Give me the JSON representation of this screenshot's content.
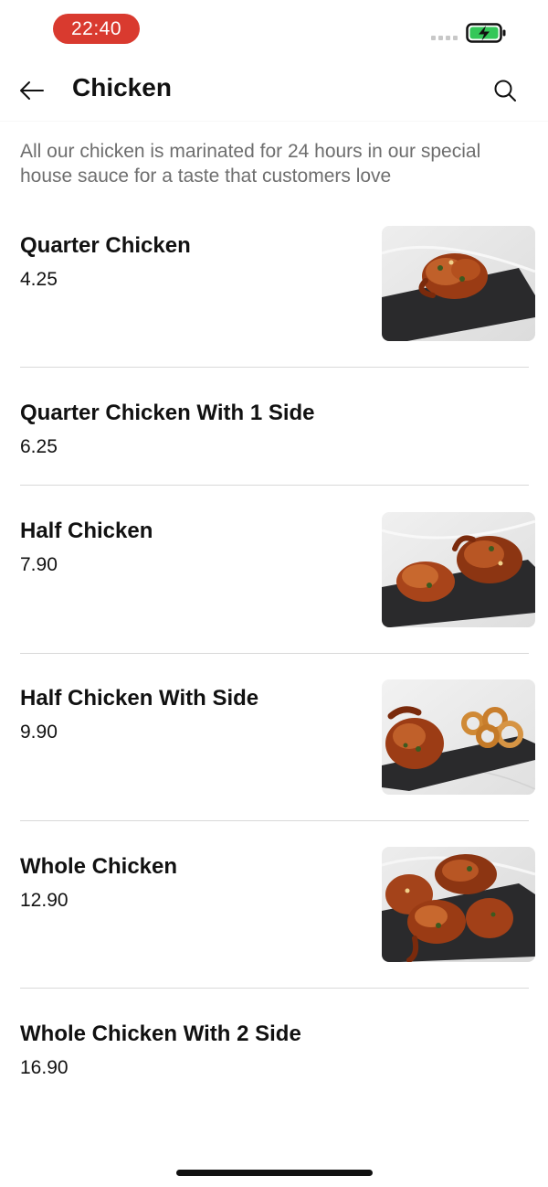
{
  "status_bar": {
    "time": "22:40",
    "time_pill_color": "#d93a2f",
    "battery_icon": "battery-charging-icon",
    "signal_icon": "signal-dots-icon"
  },
  "header": {
    "title": "Chicken",
    "back_icon": "arrow-left-icon",
    "search_icon": "search-icon"
  },
  "category_description": "All our chicken is marinated for 24 hours in our special house sauce for a taste that customers love",
  "menu_items": [
    {
      "name": "Quarter Chicken",
      "price": "4.25",
      "has_image": true,
      "image_icon": "quarter-chicken-photo"
    },
    {
      "name": "Quarter Chicken With 1 Side",
      "price": "6.25",
      "has_image": false
    },
    {
      "name": "Half Chicken",
      "price": "7.90",
      "has_image": true,
      "image_icon": "half-chicken-photo"
    },
    {
      "name": "Half Chicken With Side",
      "price": "9.90",
      "has_image": true,
      "image_icon": "half-chicken-with-side-photo"
    },
    {
      "name": "Whole Chicken",
      "price": "12.90",
      "has_image": true,
      "image_icon": "whole-chicken-photo"
    },
    {
      "name": "Whole Chicken With 2 Side",
      "price": "16.90",
      "has_image": false
    }
  ]
}
